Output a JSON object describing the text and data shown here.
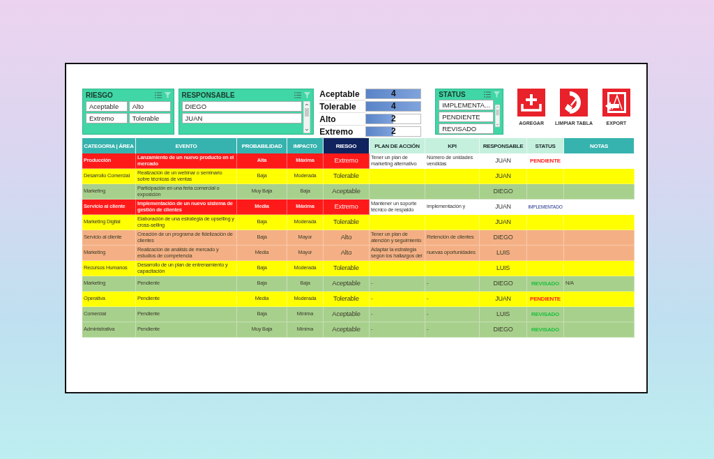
{
  "slicers_left": [
    {
      "title": "RIESGO",
      "kind": "grid",
      "scroll": false,
      "items": [
        "Aceptable",
        "Alto",
        "Extremo",
        "Tolerable"
      ]
    },
    {
      "title": "RESPONSABLE",
      "kind": "list",
      "scroll": true,
      "items": [
        "DIEGO",
        "JUAN"
      ]
    }
  ],
  "summary": [
    {
      "label": "Aceptable",
      "value": "4",
      "level": 1
    },
    {
      "label": "Tolerable",
      "value": "4",
      "level": 1
    },
    {
      "label": "Alto",
      "value": "2",
      "level": 0.5
    },
    {
      "label": "Extremo",
      "value": "2",
      "level": 0.5
    }
  ],
  "status_slicer": {
    "title": "STATUS",
    "kind": "list",
    "scroll": true,
    "items": [
      "IMPLEMENTA...",
      "PENDIENTE",
      "REVISADO"
    ]
  },
  "actions": [
    {
      "label": "AGREGAR",
      "kind": "add"
    },
    {
      "label": "LIMPIAR TABLA",
      "kind": "clear"
    },
    {
      "label": "EXPORT",
      "kind": "export"
    }
  ],
  "table": {
    "columns": [
      {
        "label": "CATEGORIA | ÁREA",
        "kind": "teal"
      },
      {
        "label": "EVENTO",
        "kind": "teal"
      },
      {
        "label": "PROBABILIDAD",
        "kind": "teal"
      },
      {
        "label": "IMPACTO",
        "kind": "teal"
      },
      {
        "label": "RIESGO",
        "kind": "navy"
      },
      {
        "label": "PLAN DE ACCIÓN",
        "kind": "mint"
      },
      {
        "label": "KPI",
        "kind": "mint"
      },
      {
        "label": "RESPONSABLE",
        "kind": "mint"
      },
      {
        "label": "STATUS",
        "kind": "mint"
      },
      {
        "label": "NOTAS",
        "kind": "teal"
      }
    ],
    "rows": [
      {
        "kind": "extremo",
        "categoria": "Producción",
        "evento": "Lanzamiento de un nuevo producto en el mercado",
        "probabilidad": "Alta",
        "impacto": "Máxima",
        "riesgo": "Extremo",
        "plan": "Tener un plan de marketing alternativo",
        "kpi": "Número de unidades vendidas",
        "responsable": "JUAN",
        "status": {
          "text": "PENDIENTE",
          "kind": "pendiente"
        }
      },
      {
        "kind": "tolerable",
        "categoria": "Desarrollo Comercial",
        "evento": "Realización de un webinar o seminario sobre técnicas de ventas",
        "probabilidad": "Baja",
        "impacto": "Moderada",
        "riesgo": "Tolerable",
        "responsable": "JUAN"
      },
      {
        "kind": "aceptable",
        "categoria": "Marketing",
        "evento": "Participación en una feria comercial o exposición",
        "probabilidad": "Muy Baja",
        "impacto": "Baja",
        "riesgo": "Aceptable",
        "responsable": "DIEGO"
      },
      {
        "kind": "extremo",
        "categoria": "Servicio al cliente",
        "evento": "Implementación de un nuevo sistema de gestión de clientes",
        "probabilidad": "Media",
        "impacto": "Máxima",
        "riesgo": "Extremo",
        "plan": "Mantener un soporte técnico de respaldo",
        "kpi": "implementación y",
        "responsable": "JUAN",
        "status": {
          "text": "IMPLEMENTADO",
          "kind": "implementado"
        }
      },
      {
        "kind": "tolerable",
        "categoria": "Marketing Digital",
        "evento": "Elaboración de una estrategia de upselling y cross-selling",
        "probabilidad": "Baja",
        "impacto": "Moderada",
        "riesgo": "Tolerable",
        "responsable": "JUAN"
      },
      {
        "kind": "alto",
        "categoria": "Servicio al cliente",
        "evento": "Creación de un programa de fidelización de clientes",
        "probabilidad": "Baja",
        "impacto": "Mayor",
        "riesgo": "Alto",
        "plan": "Tener un plan de atención y seguimiento",
        "kpi": "Retención de clientes",
        "responsable": "DIEGO"
      },
      {
        "kind": "alto",
        "categoria": "Marketing",
        "evento": "Realización de análisis de mercado y estudios de competencia",
        "probabilidad": "Media",
        "impacto": "Mayor",
        "riesgo": "Alto",
        "plan": "Adaptar la estrategia según los hallazgos del",
        "kpi": "nuevas oportunidades",
        "responsable": "LUIS"
      },
      {
        "kind": "tolerable",
        "categoria": "Recursos Humanos",
        "evento": "Desarrollo de un plan de entrenamiento y capacitación",
        "probabilidad": "Baja",
        "impacto": "Moderada",
        "riesgo": "Tolerable",
        "responsable": "LUIS"
      },
      {
        "kind": "aceptable",
        "categoria": "Marketing",
        "evento": "Pendiente",
        "probabilidad": "Baja",
        "impacto": "Baja",
        "riesgo": "Aceptable",
        "plan": "-",
        "kpi": "-",
        "responsable": "DIEGO",
        "status": {
          "text": "REVISADO",
          "kind": "revisado"
        },
        "notas": "N/A"
      },
      {
        "kind": "tolerable",
        "categoria": "Operativa",
        "evento": "Pendiente",
        "probabilidad": "Media",
        "impacto": "Moderada",
        "riesgo": "Tolerable",
        "plan": "-",
        "kpi": "-",
        "responsable": "JUAN",
        "status": {
          "text": "PENDIENTE",
          "kind": "pendiente"
        }
      },
      {
        "kind": "aceptable",
        "categoria": "Comercial",
        "evento": "Pendiente",
        "probabilidad": "Baja",
        "impacto": "Mínima",
        "riesgo": "Aceptable",
        "plan": "-",
        "kpi": "-",
        "responsable": "LUIS",
        "status": {
          "text": "REVISADO",
          "kind": "revisado"
        }
      },
      {
        "kind": "aceptable",
        "categoria": "Administrativa",
        "evento": "Pendiente",
        "probabilidad": "Muy Baja",
        "impacto": "Mínima",
        "riesgo": "Aceptable",
        "plan": "-",
        "kpi": "-",
        "responsable": "DIEGO",
        "status": {
          "text": "REVISADO",
          "kind": "revisado"
        }
      }
    ]
  }
}
